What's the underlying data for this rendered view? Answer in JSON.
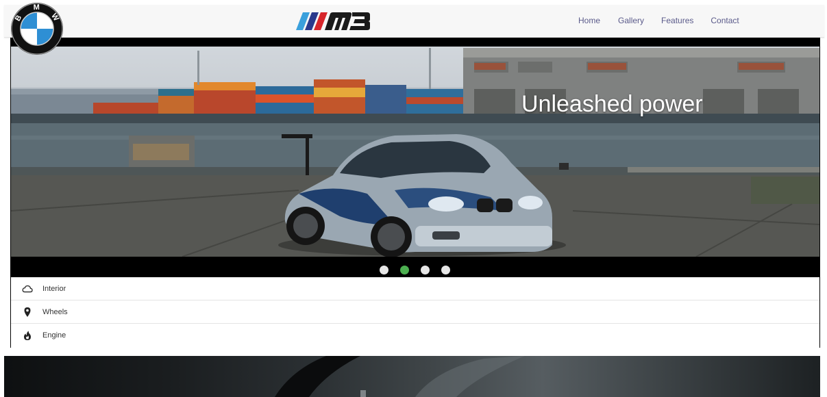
{
  "brand": {
    "roundel_icon": "bmw-roundel-icon",
    "model_logo_icon": "m3-logo-icon",
    "colors": {
      "m_light_blue": "#3aa0dc",
      "m_dark_blue": "#2a3a8c",
      "m_red": "#d7262b"
    }
  },
  "nav": {
    "items": [
      {
        "label": "Home"
      },
      {
        "label": "Gallery"
      },
      {
        "label": "Features"
      },
      {
        "label": "Contact"
      }
    ]
  },
  "carousel": {
    "slide_title": "Unleashed power",
    "slide_count": 4,
    "active_index": 1,
    "active_color": "#4caf50"
  },
  "features": {
    "items": [
      {
        "label": "Interior",
        "icon": "cloud-icon"
      },
      {
        "label": "Wheels",
        "icon": "map-pin-icon"
      },
      {
        "label": "Engine",
        "icon": "flame-icon"
      }
    ]
  }
}
